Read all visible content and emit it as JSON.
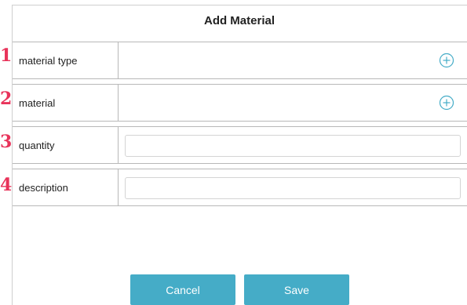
{
  "dialog": {
    "title": "Add Material"
  },
  "markers": [
    "1",
    "2",
    "3",
    "4"
  ],
  "rows": [
    {
      "label": "material type",
      "control": "add"
    },
    {
      "label": "material",
      "control": "add"
    },
    {
      "label": "quantity",
      "control": "input",
      "value": "",
      "placeholder": ""
    },
    {
      "label": "description",
      "control": "input",
      "value": "",
      "placeholder": ""
    }
  ],
  "buttons": {
    "cancel_label": "Cancel",
    "save_label": "Save"
  },
  "colors": {
    "accent": "#45acc7",
    "marker": "#e8335a",
    "divider": "#b8b8b8"
  },
  "icons": {
    "add": "circle-plus-icon"
  }
}
